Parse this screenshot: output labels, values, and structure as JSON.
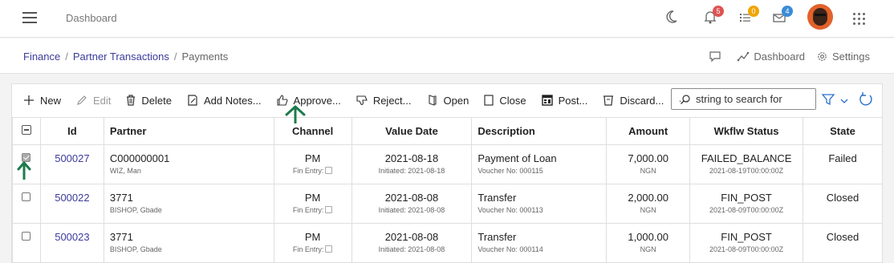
{
  "header": {
    "app_title": "Dashboard",
    "notifications": {
      "icon": "bell-icon",
      "count": "5",
      "color": "#e05252"
    },
    "tasks": {
      "icon": "task-list-icon",
      "count": "0",
      "color": "#f0a500"
    },
    "messages": {
      "icon": "envelope-icon",
      "count": "4",
      "color": "#3b8bd6"
    }
  },
  "breadcrumb": {
    "items": [
      "Finance",
      "Partner Transactions"
    ],
    "current": "Payments"
  },
  "page_tools": {
    "dashboard_label": "Dashboard",
    "settings_label": "Settings"
  },
  "toolbar": {
    "new": "New",
    "edit": "Edit",
    "delete": "Delete",
    "add_notes": "Add Notes...",
    "approve": "Approve...",
    "reject": "Reject...",
    "open": "Open",
    "close": "Close",
    "post": "Post...",
    "discard": "Discard...",
    "more": "···",
    "search_placeholder": "string to search for"
  },
  "table": {
    "columns": [
      "Id",
      "Partner",
      "Channel",
      "Value Date",
      "Description",
      "Amount",
      "Wkflw Status",
      "State"
    ],
    "rows": [
      {
        "checked": true,
        "id": "500027",
        "partner": "C000000001",
        "partner_sub": "WIZ, Man",
        "channel": "PM",
        "fin_entry": "Fin Entry:",
        "value_date": "2021-08-18",
        "initiated": "Initiated: 2021-08-18",
        "description": "Payment of Loan",
        "voucher": "Voucher No: 000115",
        "amount": "7,000.00",
        "currency": "NGN",
        "wkflw_status": "FAILED_BALANCE",
        "wkflw_date": "2021-08-19T00:00:00Z",
        "state": "Failed"
      },
      {
        "checked": false,
        "id": "500022",
        "partner": "3771",
        "partner_sub": "BISHOP, Gbade",
        "channel": "PM",
        "fin_entry": "Fin Entry:",
        "value_date": "2021-08-08",
        "initiated": "Initiated: 2021-08-08",
        "description": "Transfer",
        "voucher": "Voucher No: 000113",
        "amount": "2,000.00",
        "currency": "NGN",
        "wkflw_status": "FIN_POST",
        "wkflw_date": "2021-08-09T00:00:00Z",
        "state": "Closed"
      },
      {
        "checked": false,
        "id": "500023",
        "partner": "3771",
        "partner_sub": "BISHOP, Gbade",
        "channel": "PM",
        "fin_entry": "Fin Entry:",
        "value_date": "2021-08-08",
        "initiated": "Initiated: 2021-08-08",
        "description": "Transfer",
        "voucher": "Voucher No: 000114",
        "amount": "1,000.00",
        "currency": "NGN",
        "wkflw_status": "FIN_POST",
        "wkflw_date": "2021-08-09T00:00:00Z",
        "state": "Closed"
      }
    ]
  },
  "annotations": {
    "arrow_color": "#1e7a4c"
  }
}
